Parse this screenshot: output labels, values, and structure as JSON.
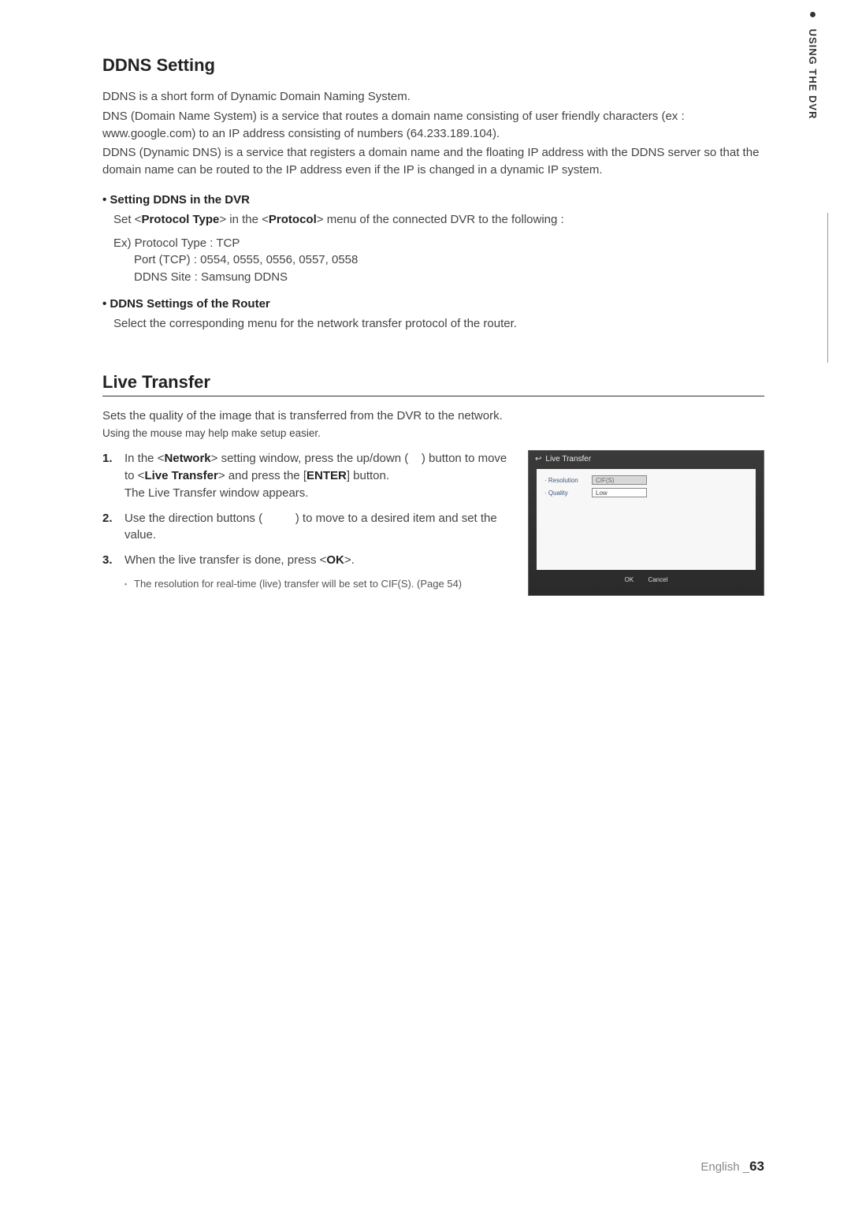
{
  "sideTab": {
    "bullet": "●",
    "text": "USING THE DVR"
  },
  "ddns": {
    "heading": "DDNS Setting",
    "intro1": "DDNS is a short form of Dynamic Domain Naming System.",
    "intro2": "DNS (Domain Name System) is a service that routes a domain name consisting of user friendly characters (ex : www.google.com) to an IP address consisting of numbers (64.233.189.104).",
    "intro3": "DDNS (Dynamic DNS) is a service that registers a domain name and the floating IP address with the DDNS server so that the domain name can be routed to the IP address even if the IP is changed in a dynamic IP system.",
    "bullet1Heading": "• Setting DDNS in the DVR",
    "bullet1Set_pre": "Set <",
    "bullet1Set_bold1": "Protocol Type",
    "bullet1Set_mid": "> in the <",
    "bullet1Set_bold2": "Protocol",
    "bullet1Set_post": "> menu of the connected DVR to the following :",
    "exLine1": "Ex) Protocol Type : TCP",
    "exLine2": "Port (TCP) : 0554, 0555, 0556, 0557, 0558",
    "exLine3": "DDNS Site : Samsung DDNS",
    "bullet2Heading": "• DDNS Settings of the Router",
    "bullet2Body": "Select the corresponding menu for the network transfer protocol of the router."
  },
  "live": {
    "heading": "Live Transfer",
    "intro": "Sets the quality of the image that is transferred from the DVR to the network.",
    "mouseHint": "Using the mouse may help make setup easier.",
    "step1_a": "In the <",
    "step1_b": "Network",
    "step1_c": "> setting window, press the up/down (    ) button to move to <",
    "step1_d": "Live Transfer",
    "step1_e": "> and press the [",
    "step1_f": "ENTER",
    "step1_g": "] button.",
    "step1_sub": "The Live Transfer window appears.",
    "step2": "Use the direction buttons (          ) to move to a desired item and set the value.",
    "step3_a": "When the live transfer is done, press <",
    "step3_b": "OK",
    "step3_c": ">.",
    "note": "The resolution for real-time (live) transfer will be set to CIF(S). (Page 54)"
  },
  "screenshot": {
    "returnIcon": "↩",
    "title": "Live Transfer",
    "resolutionLabel": "· Resolution",
    "resolutionValue": "CIF(S)",
    "qualityLabel": "· Quality",
    "qualityValue": "Low",
    "okBtn": "OK",
    "cancelBtn": "Cancel"
  },
  "footer": {
    "lang": "English _",
    "page": "63"
  }
}
